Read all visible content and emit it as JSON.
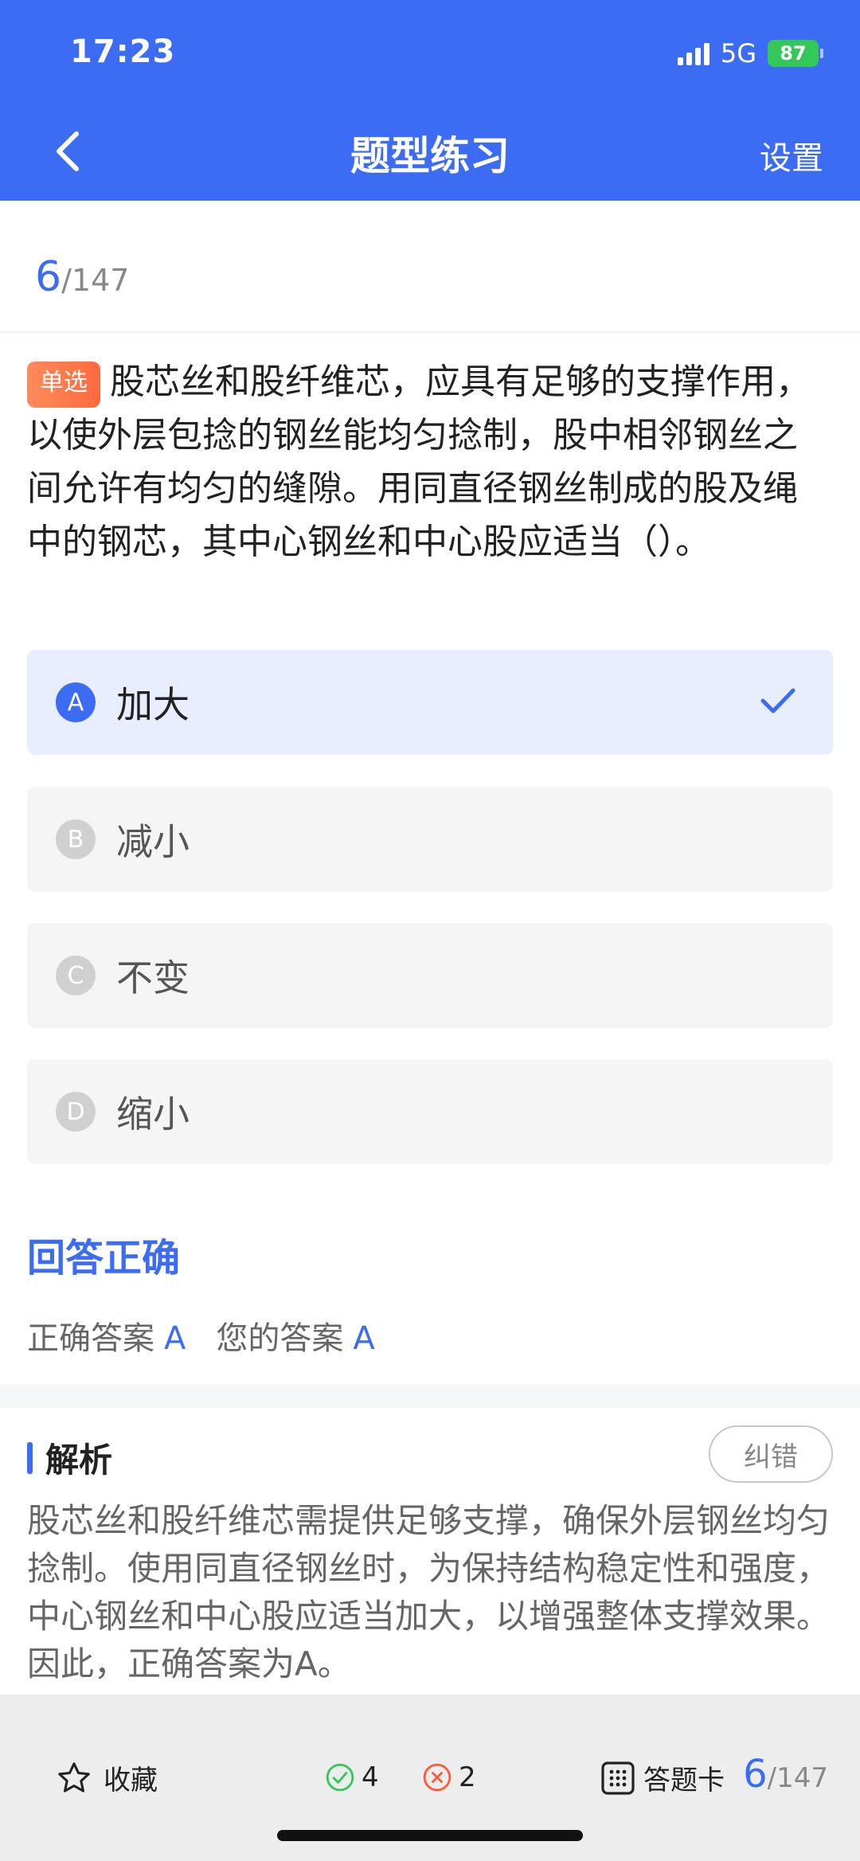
{
  "status_bar": {
    "time": "17:23",
    "network": "5G",
    "battery": "87"
  },
  "header": {
    "title": "题型练习",
    "settings_label": "设置"
  },
  "progress": {
    "current": "6",
    "total": "/147"
  },
  "question": {
    "type_tag": "单选",
    "text": "股芯丝和股纤维芯，应具有足够的支撑作用，以使外层包捻的钢丝能均匀捻制，股中相邻钢丝之间允许有均匀的缝隙。用同直径钢丝制成的股及绳中的钢芯，其中心钢丝和中心股应适当（）。"
  },
  "options": [
    {
      "letter": "A",
      "text": "加大",
      "selected": true
    },
    {
      "letter": "B",
      "text": "减小",
      "selected": false
    },
    {
      "letter": "C",
      "text": "不变",
      "selected": false
    },
    {
      "letter": "D",
      "text": "缩小",
      "selected": false
    }
  ],
  "result": {
    "title": "回答正确",
    "correct_label": "正确答案",
    "correct_value": "A",
    "your_label": "您的答案",
    "your_value": "A"
  },
  "analysis": {
    "title": "解析",
    "report_label": "纠错",
    "text": "股芯丝和股纤维芯需提供足够支撑，确保外层钢丝均匀捻制。使用同直径钢丝时，为保持结构稳定性和强度，中心钢丝和中心股应适当加大，以增强整体支撑效果。因此，正确答案为A。"
  },
  "bottom_bar": {
    "favorite_label": "收藏",
    "correct_count": "4",
    "wrong_count": "2",
    "answer_card_label": "答题卡",
    "current": "6",
    "total": "/147"
  },
  "colors": {
    "primary": "#3b6cf3",
    "success": "#34c759",
    "tag": "#ff7a4a",
    "wrong": "#ff5a3d"
  }
}
